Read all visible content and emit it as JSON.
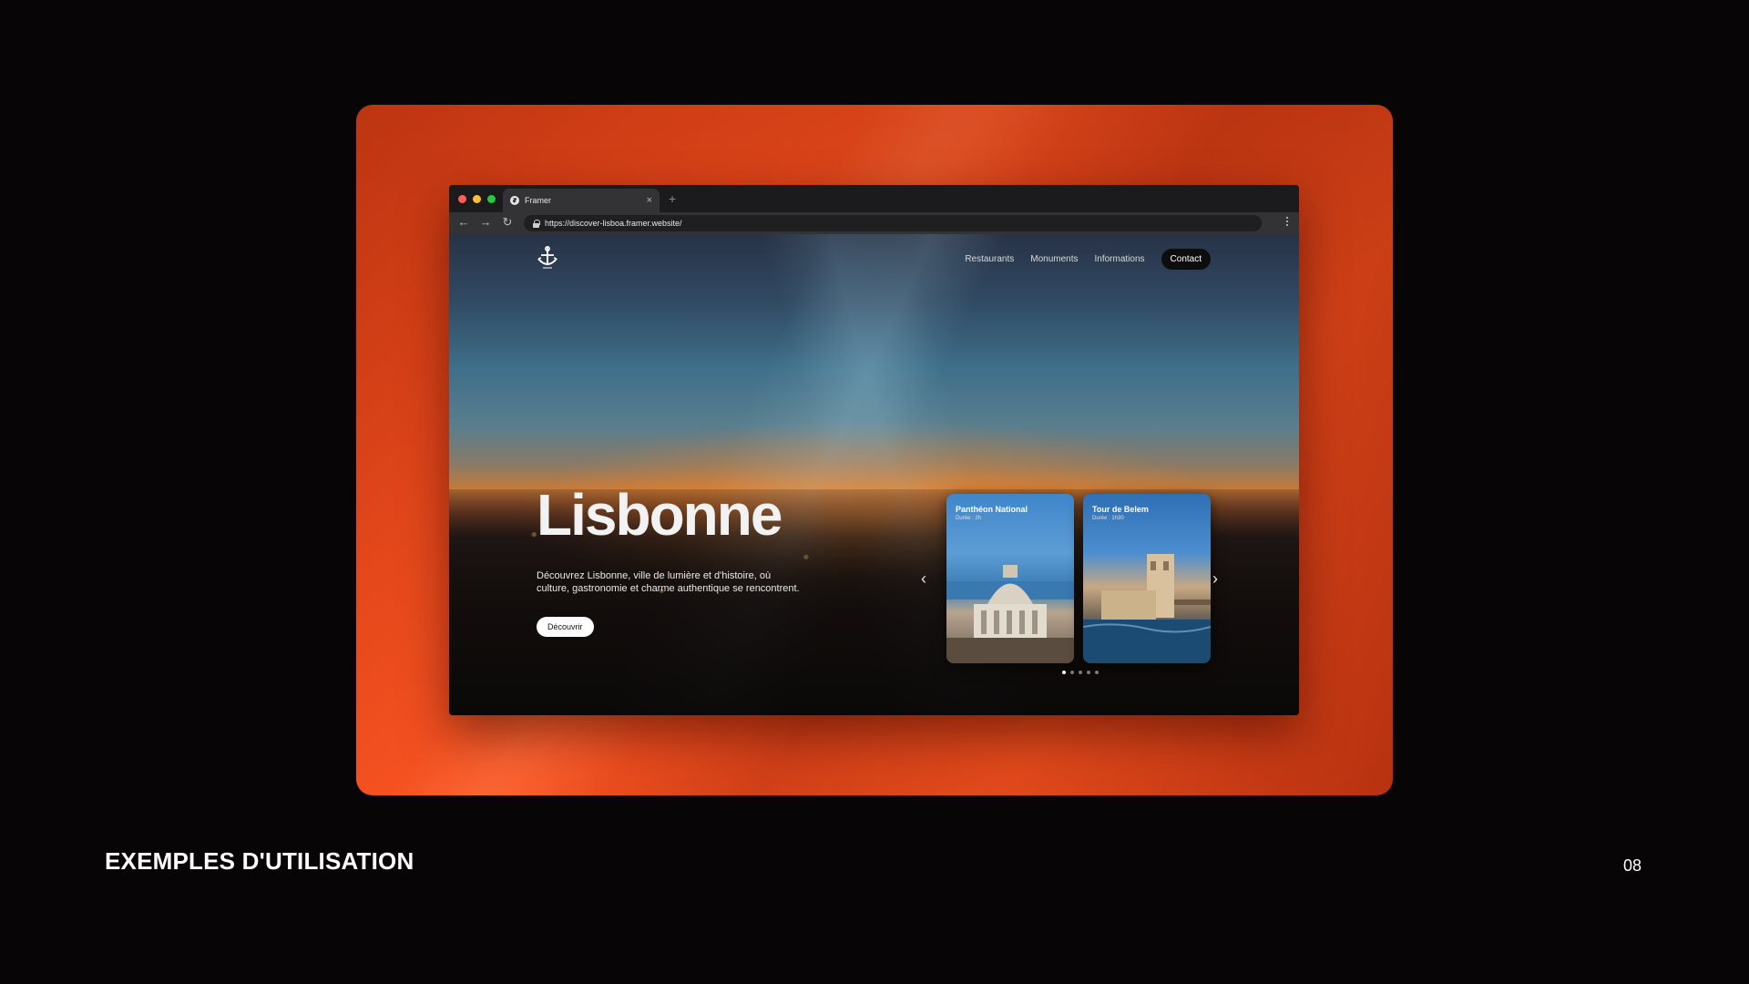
{
  "browser": {
    "tab_title": "Framer",
    "tab_close": "×",
    "new_tab": "+",
    "url": "https://discover-lisboa.framer.website/",
    "nav": {
      "back": "←",
      "forward": "→",
      "reload": "↻"
    },
    "traffic_light_colors": [
      "#ff5f57",
      "#febc2e",
      "#28c840"
    ]
  },
  "site": {
    "nav_items": [
      "Restaurants",
      "Monuments",
      "Informations"
    ],
    "contact_label": "Contact",
    "hero_title": "Lisbonne",
    "hero_description": "Découvrez Lisbonne, ville de lumière et d'histoire, où culture, gastronomie et charme authentique se rencontrent.",
    "discover_label": "Découvrir",
    "arrow_prev": "‹",
    "arrow_next": "›",
    "cards": [
      {
        "title": "Panthéon National",
        "duration": "Durée : 2h"
      },
      {
        "title": "Tour de Belem",
        "duration": "Durée : 1h30"
      }
    ],
    "pager_count": 5,
    "pager_active": 1
  },
  "slide": {
    "label": "EXEMPLES D'UTILISATION",
    "number": "08"
  },
  "colors": {
    "accent_orange": "#f25220",
    "background": "#070506"
  }
}
